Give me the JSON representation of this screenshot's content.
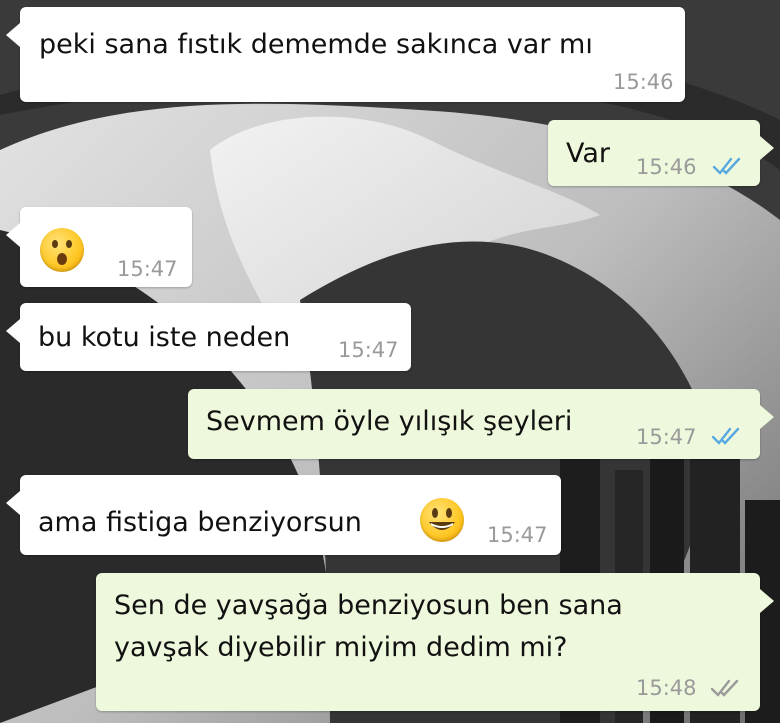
{
  "messages": [
    {
      "id": "m1",
      "text": "peki sana fıstık dememde sakınca var mı",
      "time": "15:46"
    },
    {
      "id": "m2",
      "text": "Var",
      "time": "15:46",
      "status": "read"
    },
    {
      "id": "m3",
      "emoji": "surprised-face",
      "time": "15:47"
    },
    {
      "id": "m4",
      "text": "bu kotu iste neden",
      "time": "15:47"
    },
    {
      "id": "m5",
      "text": "Sevmem öyle yılışık şeyleri",
      "time": "15:47",
      "status": "read"
    },
    {
      "id": "m6",
      "text": "ama fistiga benziyorsun",
      "emoji": "grinning-face",
      "time": "15:47"
    },
    {
      "id": "m7",
      "line1": "Sen de yavşağa benziyosun ben sana",
      "line2": "yavşak diyebilir miyim dedim mi?",
      "time": "15:48",
      "status": "delivered"
    }
  ],
  "colors": {
    "incoming_bubble": "#ffffff",
    "outgoing_bubble": "#eef8dc",
    "read_ticks": "#58a9e0",
    "delivered_ticks": "#9a9a9a",
    "timestamp": "#9a9a9a"
  }
}
